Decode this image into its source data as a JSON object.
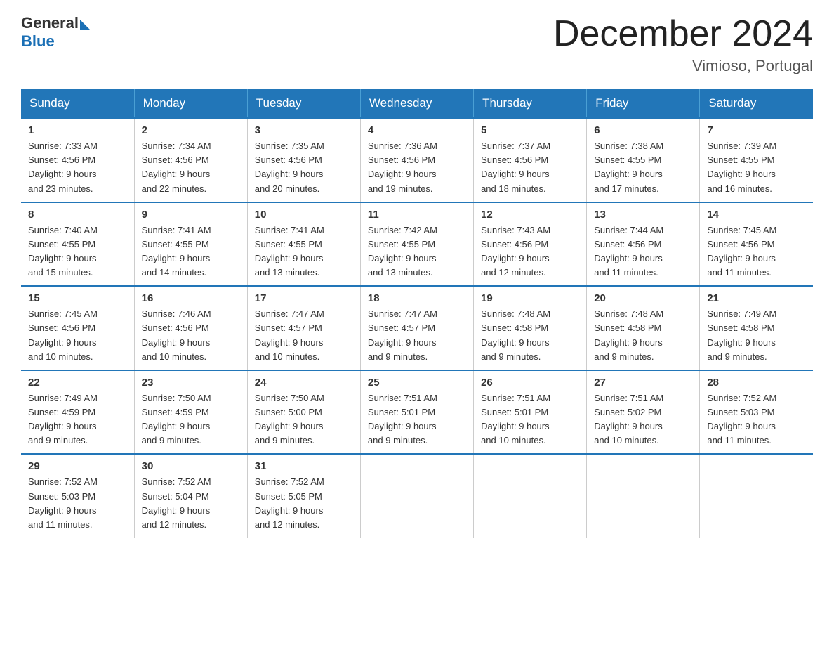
{
  "header": {
    "logo_general": "General",
    "logo_blue": "Blue",
    "title": "December 2024",
    "subtitle": "Vimioso, Portugal"
  },
  "weekdays": [
    "Sunday",
    "Monday",
    "Tuesday",
    "Wednesday",
    "Thursday",
    "Friday",
    "Saturday"
  ],
  "weeks": [
    [
      {
        "day": "1",
        "sunrise": "7:33 AM",
        "sunset": "4:56 PM",
        "daylight": "9 hours and 23 minutes."
      },
      {
        "day": "2",
        "sunrise": "7:34 AM",
        "sunset": "4:56 PM",
        "daylight": "9 hours and 22 minutes."
      },
      {
        "day": "3",
        "sunrise": "7:35 AM",
        "sunset": "4:56 PM",
        "daylight": "9 hours and 20 minutes."
      },
      {
        "day": "4",
        "sunrise": "7:36 AM",
        "sunset": "4:56 PM",
        "daylight": "9 hours and 19 minutes."
      },
      {
        "day": "5",
        "sunrise": "7:37 AM",
        "sunset": "4:56 PM",
        "daylight": "9 hours and 18 minutes."
      },
      {
        "day": "6",
        "sunrise": "7:38 AM",
        "sunset": "4:55 PM",
        "daylight": "9 hours and 17 minutes."
      },
      {
        "day": "7",
        "sunrise": "7:39 AM",
        "sunset": "4:55 PM",
        "daylight": "9 hours and 16 minutes."
      }
    ],
    [
      {
        "day": "8",
        "sunrise": "7:40 AM",
        "sunset": "4:55 PM",
        "daylight": "9 hours and 15 minutes."
      },
      {
        "day": "9",
        "sunrise": "7:41 AM",
        "sunset": "4:55 PM",
        "daylight": "9 hours and 14 minutes."
      },
      {
        "day": "10",
        "sunrise": "7:41 AM",
        "sunset": "4:55 PM",
        "daylight": "9 hours and 13 minutes."
      },
      {
        "day": "11",
        "sunrise": "7:42 AM",
        "sunset": "4:55 PM",
        "daylight": "9 hours and 13 minutes."
      },
      {
        "day": "12",
        "sunrise": "7:43 AM",
        "sunset": "4:56 PM",
        "daylight": "9 hours and 12 minutes."
      },
      {
        "day": "13",
        "sunrise": "7:44 AM",
        "sunset": "4:56 PM",
        "daylight": "9 hours and 11 minutes."
      },
      {
        "day": "14",
        "sunrise": "7:45 AM",
        "sunset": "4:56 PM",
        "daylight": "9 hours and 11 minutes."
      }
    ],
    [
      {
        "day": "15",
        "sunrise": "7:45 AM",
        "sunset": "4:56 PM",
        "daylight": "9 hours and 10 minutes."
      },
      {
        "day": "16",
        "sunrise": "7:46 AM",
        "sunset": "4:56 PM",
        "daylight": "9 hours and 10 minutes."
      },
      {
        "day": "17",
        "sunrise": "7:47 AM",
        "sunset": "4:57 PM",
        "daylight": "9 hours and 10 minutes."
      },
      {
        "day": "18",
        "sunrise": "7:47 AM",
        "sunset": "4:57 PM",
        "daylight": "9 hours and 9 minutes."
      },
      {
        "day": "19",
        "sunrise": "7:48 AM",
        "sunset": "4:58 PM",
        "daylight": "9 hours and 9 minutes."
      },
      {
        "day": "20",
        "sunrise": "7:48 AM",
        "sunset": "4:58 PM",
        "daylight": "9 hours and 9 minutes."
      },
      {
        "day": "21",
        "sunrise": "7:49 AM",
        "sunset": "4:58 PM",
        "daylight": "9 hours and 9 minutes."
      }
    ],
    [
      {
        "day": "22",
        "sunrise": "7:49 AM",
        "sunset": "4:59 PM",
        "daylight": "9 hours and 9 minutes."
      },
      {
        "day": "23",
        "sunrise": "7:50 AM",
        "sunset": "4:59 PM",
        "daylight": "9 hours and 9 minutes."
      },
      {
        "day": "24",
        "sunrise": "7:50 AM",
        "sunset": "5:00 PM",
        "daylight": "9 hours and 9 minutes."
      },
      {
        "day": "25",
        "sunrise": "7:51 AM",
        "sunset": "5:01 PM",
        "daylight": "9 hours and 9 minutes."
      },
      {
        "day": "26",
        "sunrise": "7:51 AM",
        "sunset": "5:01 PM",
        "daylight": "9 hours and 10 minutes."
      },
      {
        "day": "27",
        "sunrise": "7:51 AM",
        "sunset": "5:02 PM",
        "daylight": "9 hours and 10 minutes."
      },
      {
        "day": "28",
        "sunrise": "7:52 AM",
        "sunset": "5:03 PM",
        "daylight": "9 hours and 11 minutes."
      }
    ],
    [
      {
        "day": "29",
        "sunrise": "7:52 AM",
        "sunset": "5:03 PM",
        "daylight": "9 hours and 11 minutes."
      },
      {
        "day": "30",
        "sunrise": "7:52 AM",
        "sunset": "5:04 PM",
        "daylight": "9 hours and 12 minutes."
      },
      {
        "day": "31",
        "sunrise": "7:52 AM",
        "sunset": "5:05 PM",
        "daylight": "9 hours and 12 minutes."
      },
      null,
      null,
      null,
      null
    ]
  ]
}
